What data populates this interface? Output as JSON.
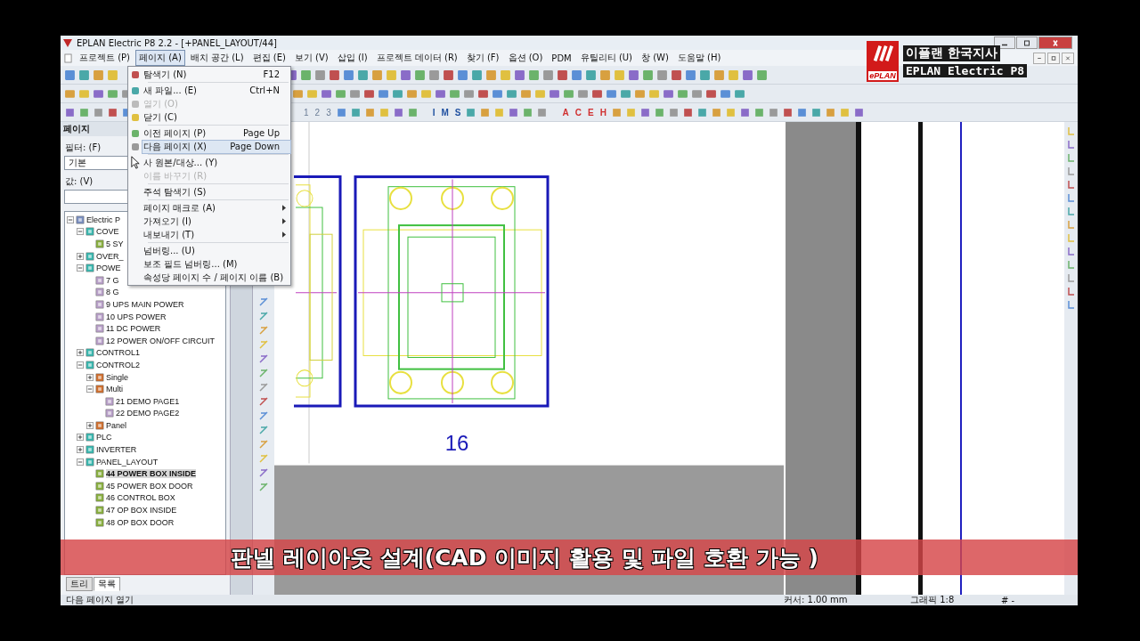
{
  "window": {
    "title": "EPLAN Electric P8 2.2 - [+PANEL_LAYOUT/44]"
  },
  "menu_bar": [
    {
      "label": "프로젝트 (P)",
      "selected": false
    },
    {
      "label": "페이지 (A)",
      "selected": true
    },
    {
      "label": "배치 공간 (L)",
      "selected": false
    },
    {
      "label": "편집 (E)",
      "selected": false
    },
    {
      "label": "보기 (V)",
      "selected": false
    },
    {
      "label": "삽입 (I)",
      "selected": false
    },
    {
      "label": "프로젝트 데이터 (R)",
      "selected": false
    },
    {
      "label": "찾기 (F)",
      "selected": false
    },
    {
      "label": "옵션 (O)",
      "selected": false
    },
    {
      "label": "PDM",
      "selected": false
    },
    {
      "label": "유틸리티 (U)",
      "selected": false
    },
    {
      "label": "창 (W)",
      "selected": false
    },
    {
      "label": "도움말 (H)",
      "selected": false
    }
  ],
  "toolbar_3": {
    "button_groups": [
      [
        "1",
        "2",
        "3"
      ],
      [
        "I",
        "M",
        "S"
      ],
      [
        "A",
        "C",
        "E",
        "H"
      ]
    ]
  },
  "page_panel": {
    "title": "페이지",
    "filter_label": "필터: (F)",
    "filter_value": "기본",
    "value_label": "값: (V)",
    "tree": [
      {
        "label": "Electric P",
        "kind": "project",
        "expanded": true,
        "selected": false,
        "children": [
          {
            "label": "COVE",
            "kind": "structure",
            "expanded": true,
            "selected": false,
            "children": [
              {
                "label": "5 SY",
                "kind": "layout-page",
                "selected": false
              }
            ]
          },
          {
            "label": "OVER_",
            "kind": "structure",
            "expanded": false,
            "selected": false
          },
          {
            "label": "POWE",
            "kind": "structure",
            "expanded": true,
            "selected": false,
            "children": [
              {
                "label": "7 G",
                "kind": "schematic-page",
                "selected": false
              },
              {
                "label": "8 G",
                "kind": "schematic-page",
                "selected": false
              },
              {
                "label": "9 UPS MAIN POWER",
                "kind": "schematic-page",
                "selected": false
              },
              {
                "label": "10 UPS POWER",
                "kind": "schematic-page",
                "selected": false
              },
              {
                "label": "11 DC POWER",
                "kind": "schematic-page",
                "selected": false
              },
              {
                "label": "12 POWER ON/OFF CIRCUIT",
                "kind": "schematic-page",
                "selected": false
              }
            ]
          },
          {
            "label": "CONTROL1",
            "kind": "structure",
            "expanded": false,
            "selected": false
          },
          {
            "label": "CONTROL2",
            "kind": "structure",
            "expanded": true,
            "selected": false,
            "children": [
              {
                "label": "Single",
                "kind": "folder",
                "expanded": false,
                "selected": false
              },
              {
                "label": "Multi",
                "kind": "folder",
                "expanded": true,
                "selected": false,
                "children": [
                  {
                    "label": "21 DEMO PAGE1",
                    "kind": "schematic-page",
                    "selected": false
                  },
                  {
                    "label": "22 DEMO PAGE2",
                    "kind": "schematic-page",
                    "selected": false
                  }
                ]
              },
              {
                "label": "Panel",
                "kind": "folder",
                "expanded": false,
                "selected": false
              }
            ]
          },
          {
            "label": "PLC",
            "kind": "structure",
            "expanded": false,
            "selected": false
          },
          {
            "label": "INVERTER",
            "kind": "structure",
            "expanded": false,
            "selected": false
          },
          {
            "label": "PANEL_LAYOUT",
            "kind": "structure",
            "expanded": true,
            "selected": false,
            "children": [
              {
                "label": "44 POWER BOX INSIDE",
                "kind": "layout-page",
                "selected": true
              },
              {
                "label": "45 POWER BOX DOOR",
                "kind": "layout-page",
                "selected": false
              },
              {
                "label": "46 CONTROL BOX",
                "kind": "layout-page",
                "selected": false
              },
              {
                "label": "47 OP BOX INSIDE",
                "kind": "layout-page",
                "selected": false
              },
              {
                "label": "48 OP BOX DOOR",
                "kind": "layout-page",
                "selected": false
              }
            ]
          }
        ]
      }
    ],
    "tabs": [
      {
        "label": "트리",
        "selected": false
      },
      {
        "label": "목록",
        "selected": true
      }
    ]
  },
  "page_menu": [
    {
      "kind": "icon-item",
      "label": "탐색기 (N)",
      "shortcut": "F12",
      "disabled": false,
      "selected": false
    },
    {
      "kind": "separator"
    },
    {
      "kind": "icon-item",
      "label": "새 파일... (E)",
      "shortcut": "Ctrl+N",
      "disabled": false,
      "selected": false
    },
    {
      "kind": "icon-item",
      "label": "열기 (O)",
      "disabled": true,
      "selected": false
    },
    {
      "kind": "icon-item",
      "label": "닫기 (C)",
      "disabled": false,
      "selected": false
    },
    {
      "kind": "separator"
    },
    {
      "kind": "icon-item",
      "label": "이전 페이지 (P)",
      "shortcut": "Page Up",
      "disabled": false,
      "selected": false
    },
    {
      "kind": "icon-item",
      "label": "다음 페이지 (X)",
      "shortcut": "Page Down",
      "disabled": false,
      "selected": true
    },
    {
      "kind": "separator"
    },
    {
      "kind": "item",
      "label": "사 원본/대상... (Y)",
      "disabled": false,
      "selected": false
    },
    {
      "kind": "item",
      "label": "이름 바꾸기 (R)",
      "disabled": true,
      "selected": false
    },
    {
      "kind": "separator"
    },
    {
      "kind": "item",
      "label": "주석 탐색기 (S)",
      "disabled": false,
      "selected": false
    },
    {
      "kind": "separator"
    },
    {
      "kind": "item",
      "label": "페이지 매크로 (A)",
      "submenu": true,
      "disabled": false,
      "selected": false
    },
    {
      "kind": "item",
      "label": "가져오기 (I)",
      "submenu": true,
      "disabled": false,
      "selected": false
    },
    {
      "kind": "item",
      "label": "내보내기 (T)",
      "submenu": true,
      "disabled": false,
      "selected": false
    },
    {
      "kind": "separator"
    },
    {
      "kind": "item",
      "label": "넘버링... (U)",
      "disabled": false,
      "selected": false
    },
    {
      "kind": "item",
      "label": "보조 필드 넘버링... (M)",
      "disabled": false,
      "selected": false
    },
    {
      "kind": "item",
      "label": "속성당 페이지 수 / 페이지 이름 (B)",
      "disabled": false,
      "selected": false
    }
  ],
  "canvas": {
    "item_number": "16"
  },
  "status_bar": {
    "message": "다음 페이지 열기",
    "cursor": "커서: 1.00 mm",
    "graphic": "그래픽 1:8",
    "grid": "# -"
  },
  "logo_overlay": {
    "brand": "ePLAN",
    "line_1": "이플랜 한국지사",
    "line_2": "EPLAN Electric P8"
  },
  "caption": "판넬 레이아웃 설계(CAD 이미지 활용 및 파일 호환 가능 )"
}
